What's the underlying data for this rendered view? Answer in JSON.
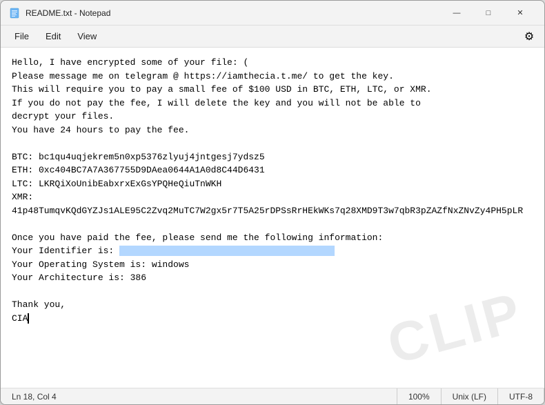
{
  "window": {
    "title": "README.txt - Notepad",
    "icon": "📄"
  },
  "menu": {
    "items": [
      "File",
      "Edit",
      "View"
    ],
    "gear_icon": "⚙"
  },
  "content": {
    "text": "Hello, I have encrypted some of your file: (\nPlease message me on telegram @ https://iamthecia.t.me/ to get the key.\nThis will require you to pay a small fee of $100 USD in BTC, ETH, LTC, or XMR.\nIf you do not pay the fee, I will delete the key and you will not be able to\ndecrypt your files.\nYou have 24 hours to pay the fee.\n\nBTC: bc1qu4uqjekrem5n0xp5376zlyuj4jntgesj7ydsz5\nETH: 0xc404BC7A7A367755D9DAea0644A1A0d8C44D6431\nLTC: LKRQiXoUnibEabxrxExGsYPQHeQiuTnWKH\nXMR:\n41p48TumqvKQdGYZJs1ALE95C2Zvq2MuTC7W2gx5r7T5A25rDPSsRrHEkWKs7q28XMD9T3w7qbR3pZAZfNxZNvZy4PH5pLR\n\nOnce you have paid the fee, please send me the following information:\nYour Identifier is:\nYour Operating System is: windows\nYour Architecture is: 386\n\nThank you,\nCIA"
  },
  "statusbar": {
    "position": "Ln 18, Col 4",
    "zoom": "100%",
    "line_ending": "Unix (LF)",
    "encoding": "UTF-8"
  },
  "titlebar": {
    "minimize": "—",
    "maximize": "□",
    "close": "✕"
  },
  "watermark": "CLIP"
}
